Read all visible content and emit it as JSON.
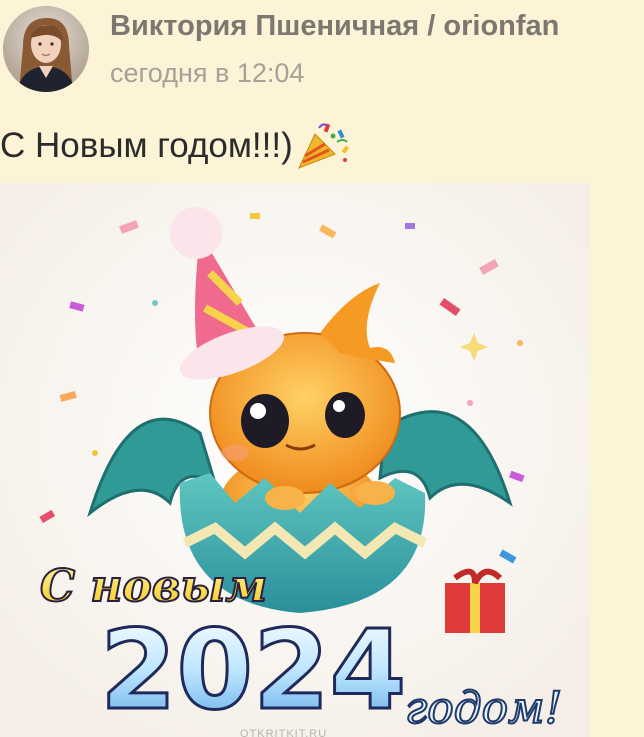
{
  "post": {
    "author": "Виктория Пшеничная / orionfan",
    "timestamp": "сегодня в 12:04",
    "text": "С Новым годом!!!)",
    "emoji": "party-popper-icon"
  },
  "card": {
    "greeting_top": "С новым",
    "year": "2024",
    "greeting_bottom": "годом!",
    "watermark": "OTKRITKIT.RU"
  },
  "colors": {
    "background": "#fdf3d6",
    "author": "#7d7771",
    "timestamp": "#a7a19a",
    "text": "#2b2b2b"
  }
}
